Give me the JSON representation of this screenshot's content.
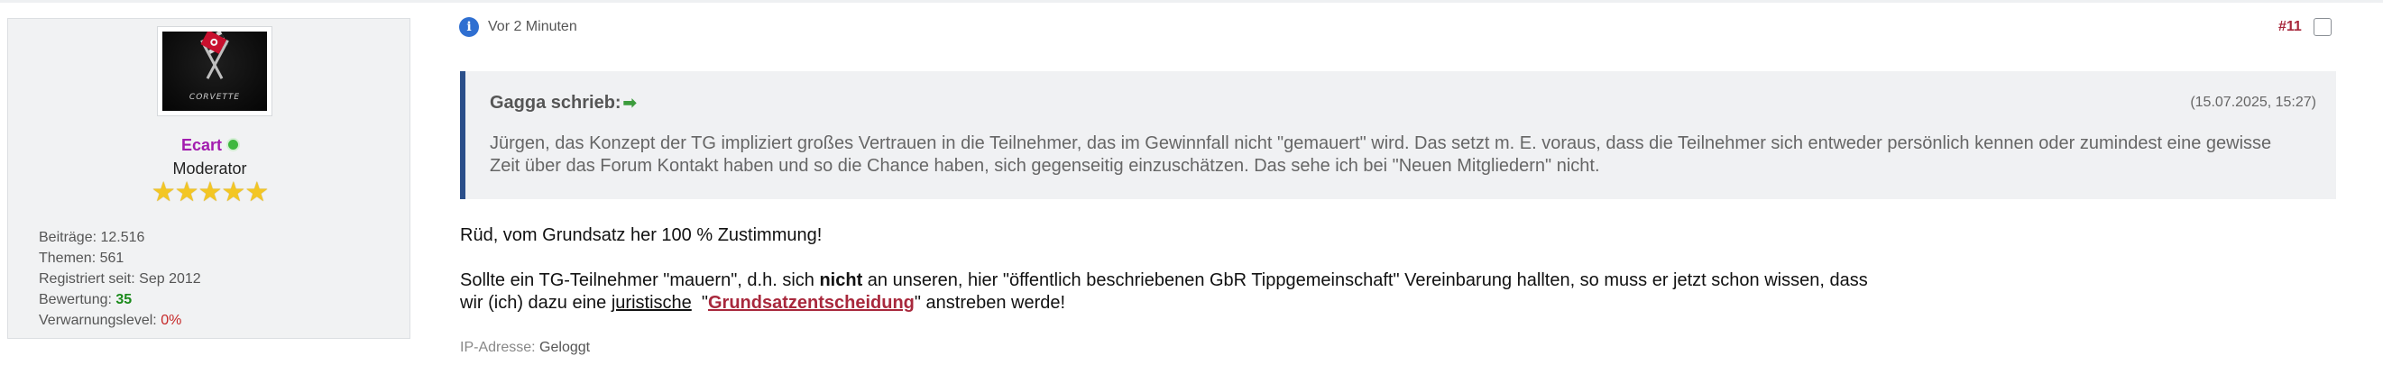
{
  "user": {
    "name": "Ecart",
    "role": "Moderator",
    "avatar_icon": "corvette-logo-icon",
    "avatar_text": "CORVETTE",
    "stars": "★★★★★",
    "stats": [
      {
        "label": "Beiträge:",
        "value": "12.516"
      },
      {
        "label": "Themen:",
        "value": "561"
      },
      {
        "label": "Registriert seit:",
        "value": "Sep 2012"
      },
      {
        "label": "Bewertung:",
        "value": "35"
      },
      {
        "label": "Verwarnungslevel:",
        "value": "0%"
      }
    ]
  },
  "post": {
    "time": "Vor 2 Minuten",
    "number": "#11",
    "quote": {
      "author": "Gagga schrieb:",
      "date": "(15.07.2025, 15:27)",
      "text": "Jürgen, das Konzept der TG impliziert großes Vertrauen in die Teilnehmer, das im Gewinnfall nicht \"gemauert\" wird. Das setzt m. E. voraus, dass die Teilnehmer sich entweder persönlich kennen oder zumindest eine gewisse Zeit über das Forum Kontakt haben und so die Chance haben, sich gegenseitig einzuschätzen. Das sehe ich bei \"Neuen Mitgliedern\" nicht."
    },
    "body": {
      "p1": "Rüd, vom Grundsatz her 100 % Zustimmung!",
      "p2_a": "Sollte ein TG-Teilnehmer \"mauern\", d.h. sich ",
      "p2_bold": "nicht",
      "p2_b": " an unseren, hier \"öffentlich beschriebenen GbR Tippgemeinschaft\" Vereinbarung hallten, so muss er jetzt schon wissen, dass",
      "p2_c": "wir (ich) dazu eine ",
      "p2_underline": "juristische",
      "p2_d": "  \"",
      "p2_link": "Grundsatzentscheidung",
      "p2_e": "\" anstreben werde!"
    },
    "ip_label": "IP-Adresse:",
    "ip_value": "Geloggt"
  },
  "colors": {
    "username": "#a21caf",
    "post_number": "#a8283c",
    "quote_border": "#2b4f8a",
    "rating": "#1a8a1a",
    "warning": "#c62828"
  }
}
